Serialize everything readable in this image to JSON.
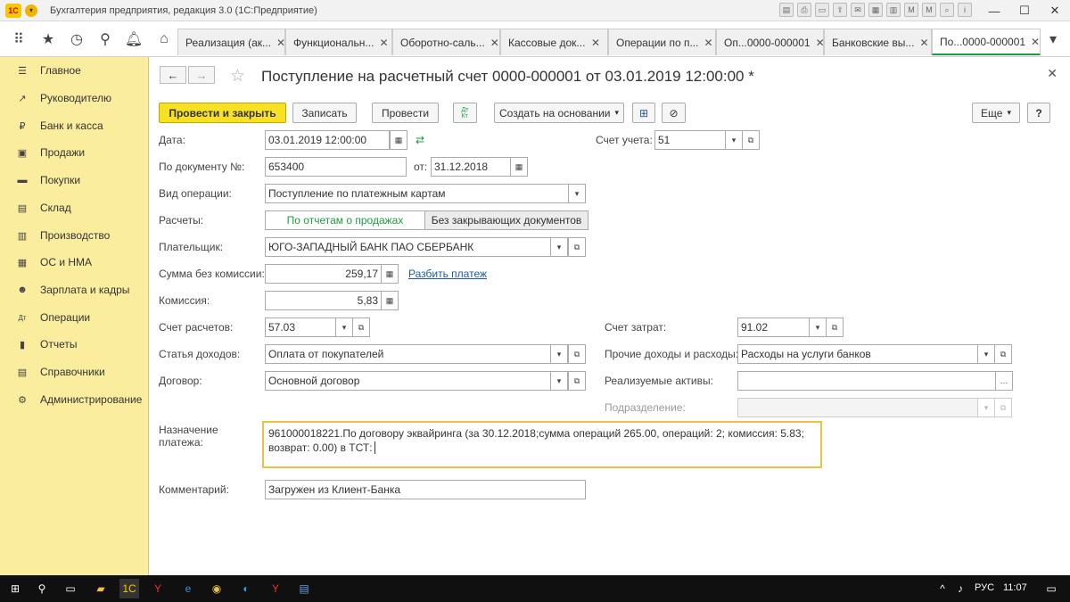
{
  "app": {
    "title": "Бухгалтерия предприятия, редакция 3.0  (1С:Предприятие)"
  },
  "tabs": [
    {
      "label": "Реализация (ак..."
    },
    {
      "label": "Функциональн..."
    },
    {
      "label": "Оборотно-саль..."
    },
    {
      "label": "Кассовые док..."
    },
    {
      "label": "Операции по п..."
    },
    {
      "label": "Оп...0000-000001"
    },
    {
      "label": "Банковские вы..."
    },
    {
      "label": "По...0000-000001"
    }
  ],
  "sidebar": {
    "items": [
      {
        "label": "Главное",
        "icon": "menu-icon"
      },
      {
        "label": "Руководителю",
        "icon": "chart-trend-icon"
      },
      {
        "label": "Банк и касса",
        "icon": "ruble-icon"
      },
      {
        "label": "Продажи",
        "icon": "cart-icon"
      },
      {
        "label": "Покупки",
        "icon": "truck-icon"
      },
      {
        "label": "Склад",
        "icon": "warehouse-icon"
      },
      {
        "label": "Производство",
        "icon": "factory-icon"
      },
      {
        "label": "ОС и НМА",
        "icon": "assets-icon"
      },
      {
        "label": "Зарплата и кадры",
        "icon": "people-icon"
      },
      {
        "label": "Операции",
        "icon": "dt-kt-icon"
      },
      {
        "label": "Отчеты",
        "icon": "report-icon"
      },
      {
        "label": "Справочники",
        "icon": "book-icon"
      },
      {
        "label": "Администрирование",
        "icon": "gear-icon"
      }
    ]
  },
  "document": {
    "title": "Поступление на расчетный счет 0000-000001 от 03.01.2019 12:00:00 *"
  },
  "buttons": {
    "post_close": "Провести и закрыть",
    "save": "Записать",
    "post": "Провести",
    "dtkt": "Дт\nКт",
    "create_based": "Создать на основании",
    "more": "Еще",
    "help": "?"
  },
  "form": {
    "date_label": "Дата:",
    "date_value": "03.01.2019 12:00:00",
    "account_label": "Счет учета:",
    "account_value": "51",
    "doc_number_label": "По документу №:",
    "doc_number_value": "653400",
    "from_label": "от:",
    "from_value": "31.12.2018",
    "operation_label": "Вид операции:",
    "operation_value": "Поступление по платежным картам",
    "settlements_label": "Расчеты:",
    "settlements_option1": "По отчетам о продажах",
    "settlements_option2": "Без закрывающих документов",
    "payer_label": "Плательщик:",
    "payer_value": "ЮГО-ЗАПАДНЫЙ БАНК ПАО СБЕРБАНК",
    "amount_label": "Сумма без комиссии:",
    "amount_value": "259,17",
    "split_link": "Разбить платеж",
    "commission_label": "Комиссия:",
    "commission_value": "5,83",
    "settle_account_label": "Счет расчетов:",
    "settle_account_value": "57.03",
    "cost_account_label": "Счет затрат:",
    "cost_account_value": "91.02",
    "income_item_label": "Статья доходов:",
    "income_item_value": "Оплата от покупателей",
    "other_label": "Прочие доходы и расходы:",
    "other_value": "Расходы на услуги банков",
    "contract_label": "Договор:",
    "contract_value": "Основной договор",
    "assets_label": "Реализуемые активы:",
    "assets_value": "",
    "subdivision_label": "Подразделение:",
    "subdivision_value": "",
    "purpose_label_1": "Назначение",
    "purpose_label_2": "платежа:",
    "purpose_value": "961000018221.По договору эквайринга (за 30.12.2018;сумма операций 265.00, операций: 2; комиссия: 5.83; возврат: 0.00) в ТСТ:",
    "comment_label": "Комментарий:",
    "comment_value": "Загружен из Клиент-Банка"
  },
  "taskbar": {
    "language": "РУС",
    "time": "11:07"
  }
}
